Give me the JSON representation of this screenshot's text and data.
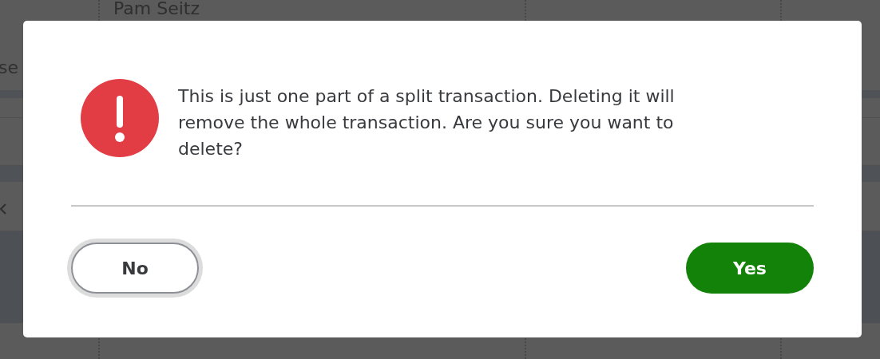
{
  "background": {
    "cells": [
      "Pam Seitz",
      "se"
    ]
  },
  "dialog": {
    "kind": "error",
    "message": "This is just one part of a split transaction. Deleting it will remove the whole transaction. Are you sure you want to delete?",
    "buttons": [
      {
        "label": "No",
        "kind": "secondary"
      },
      {
        "label": "Yes",
        "kind": "primary"
      }
    ]
  }
}
